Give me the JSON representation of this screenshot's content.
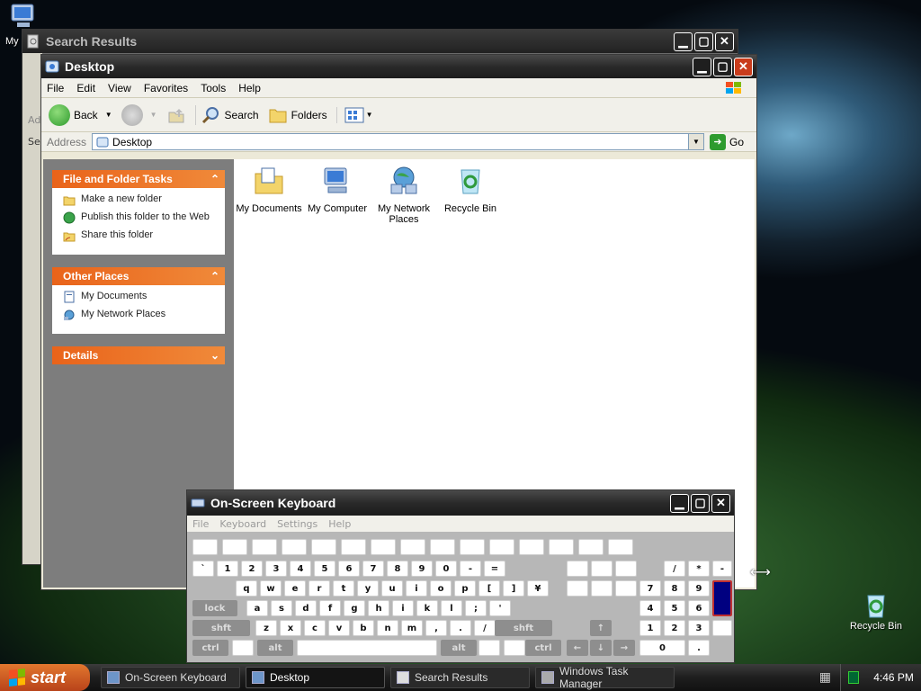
{
  "desktop": {
    "icons": [
      {
        "label": "My",
        "icon": "my-computer-icon"
      },
      {
        "label": "Recycle Bin",
        "icon": "recycle-bin-icon"
      }
    ]
  },
  "search_window": {
    "title": "Search Results",
    "side_labels": [
      "Ad",
      "Se"
    ]
  },
  "explorer": {
    "title": "Desktop",
    "menu": [
      "File",
      "Edit",
      "View",
      "Favorites",
      "Tools",
      "Help"
    ],
    "toolbar": {
      "back": "Back",
      "search": "Search",
      "folders": "Folders"
    },
    "address": {
      "label": "Address",
      "value": "Desktop",
      "go": "Go"
    },
    "task_panels": [
      {
        "title": "File and Folder Tasks",
        "items": [
          "Make a new folder",
          "Publish this folder to the Web",
          "Share this folder"
        ]
      },
      {
        "title": "Other Places",
        "items": [
          "My Documents",
          "My Network Places"
        ]
      },
      {
        "title": "Details",
        "items": []
      }
    ],
    "files": [
      {
        "label": "My Documents",
        "icon": "my-documents-icon"
      },
      {
        "label": "My Computer",
        "icon": "my-computer-icon"
      },
      {
        "label": "My Network Places",
        "icon": "network-places-icon"
      },
      {
        "label": "Recycle Bin",
        "icon": "recycle-bin-icon"
      }
    ]
  },
  "osk": {
    "title": "On-Screen Keyboard",
    "menu": [
      "File",
      "Keyboard",
      "Settings",
      "Help"
    ],
    "row_numbers": [
      "`",
      "1",
      "2",
      "3",
      "4",
      "5",
      "6",
      "7",
      "8",
      "9",
      "0",
      "-",
      "="
    ],
    "row_q": [
      "q",
      "w",
      "e",
      "r",
      "t",
      "y",
      "u",
      "i",
      "o",
      "p",
      "[",
      "]",
      "¥"
    ],
    "row_a": [
      "lock",
      "a",
      "s",
      "d",
      "f",
      "g",
      "h",
      "i",
      "k",
      "l",
      ";",
      "'"
    ],
    "row_z": [
      "shft",
      "z",
      "x",
      "c",
      "v",
      "b",
      "n",
      "m",
      ",",
      ".",
      "/",
      "shft"
    ],
    "row_bottom": [
      "ctrl",
      "alt",
      "alt",
      "ctrl"
    ],
    "numpad": [
      "/",
      "*",
      "-",
      "7",
      "8",
      "9",
      "4",
      "5",
      "6",
      "1",
      "2",
      "3",
      "0",
      "."
    ]
  },
  "taskbar": {
    "start": "start",
    "items": [
      "On-Screen Keyboard",
      "Desktop",
      "Search Results",
      "Windows Task Manager"
    ],
    "active_index": 1,
    "clock": "4:46 PM"
  },
  "colors": {
    "task_panel_header": "#e9631a",
    "start_button": "#d05a22",
    "osk_highlight": "#000080"
  }
}
